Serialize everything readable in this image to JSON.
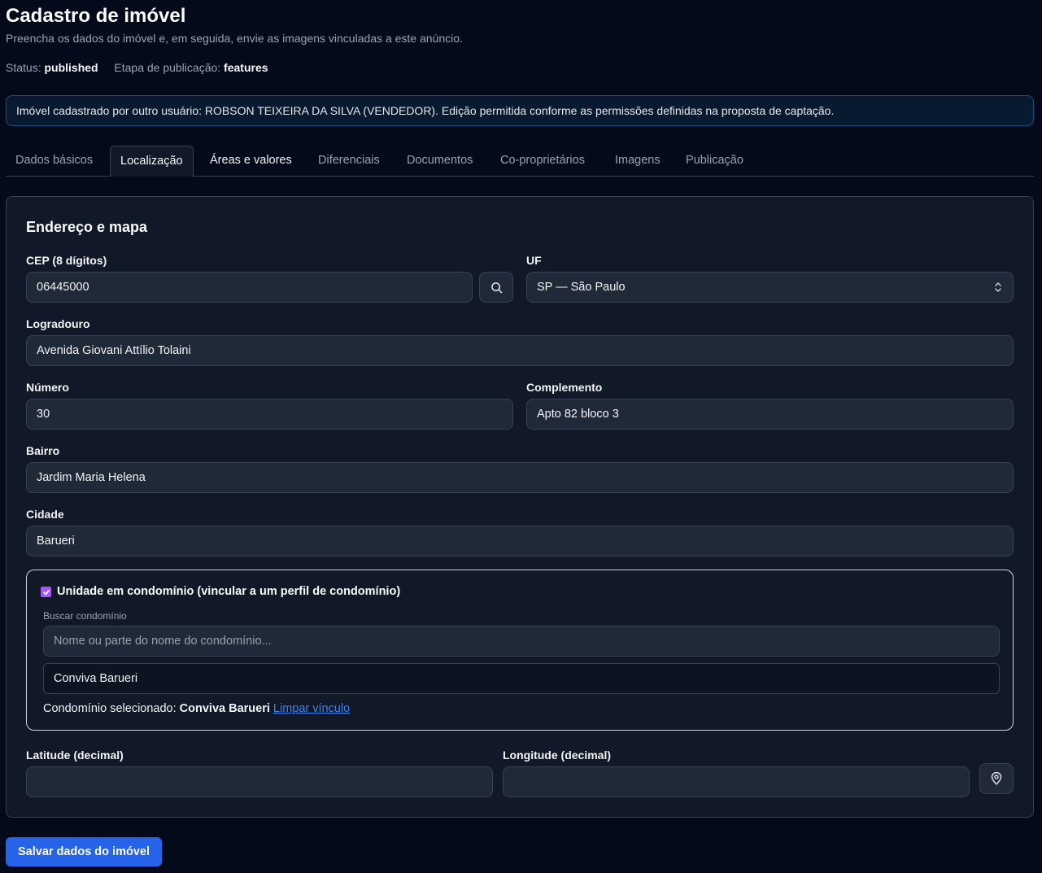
{
  "header": {
    "title": "Cadastro de imóvel",
    "subtitle": "Preencha os dados do imóvel e, em seguida, envie as imagens vinculadas a este anúncio.",
    "status_label": "Status:",
    "status_value": "published",
    "stage_label": "Etapa de publicação:",
    "stage_value": "features"
  },
  "banner": {
    "text": "Imóvel cadastrado por outro usuário: ROBSON TEIXEIRA DA SILVA (VENDEDOR). Edição permitida conforme as permissões definidas na proposta de captação."
  },
  "tabs": [
    {
      "label": "Dados básicos"
    },
    {
      "label": "Localização"
    },
    {
      "label": "Áreas e valores"
    },
    {
      "label": "Diferenciais"
    },
    {
      "label": "Documentos"
    },
    {
      "label": "Co-proprietários"
    },
    {
      "label": "Imagens"
    },
    {
      "label": "Publicação"
    }
  ],
  "active_tab": "Localização",
  "form": {
    "section_title": "Endereço e mapa",
    "cep": {
      "label": "CEP (8 dígitos)",
      "value": "06445000"
    },
    "uf": {
      "label": "UF",
      "value": "SP — São Paulo"
    },
    "logradouro": {
      "label": "Logradouro",
      "value": "Avenida Giovani Attílio Tolaini"
    },
    "numero": {
      "label": "Número",
      "value": "30"
    },
    "complemento": {
      "label": "Complemento",
      "value": "Apto 82 bloco 3"
    },
    "bairro": {
      "label": "Bairro",
      "value": "Jardim Maria Helena"
    },
    "cidade": {
      "label": "Cidade",
      "value": "Barueri"
    },
    "condominio": {
      "checkbox_label": "Unidade em condomínio (vincular a um perfil de condomínio)",
      "checked": true,
      "search_label": "Buscar condomínio",
      "search_placeholder": "Nome ou parte do nome do condomínio...",
      "result": "Conviva Barueri",
      "selected_label": "Condomínio selecionado:",
      "selected_value": "Conviva Barueri",
      "clear_link": "Limpar vínculo"
    },
    "latitude": {
      "label": "Latitude (decimal)",
      "value": ""
    },
    "longitude": {
      "label": "Longitude (decimal)",
      "value": ""
    }
  },
  "save_button": "Salvar dados do imóvel",
  "colors": {
    "background": "#050a1a",
    "card": "#111827",
    "primary": "#2563eb",
    "checkbox": "#a855f7",
    "link": "#3b82f6"
  }
}
